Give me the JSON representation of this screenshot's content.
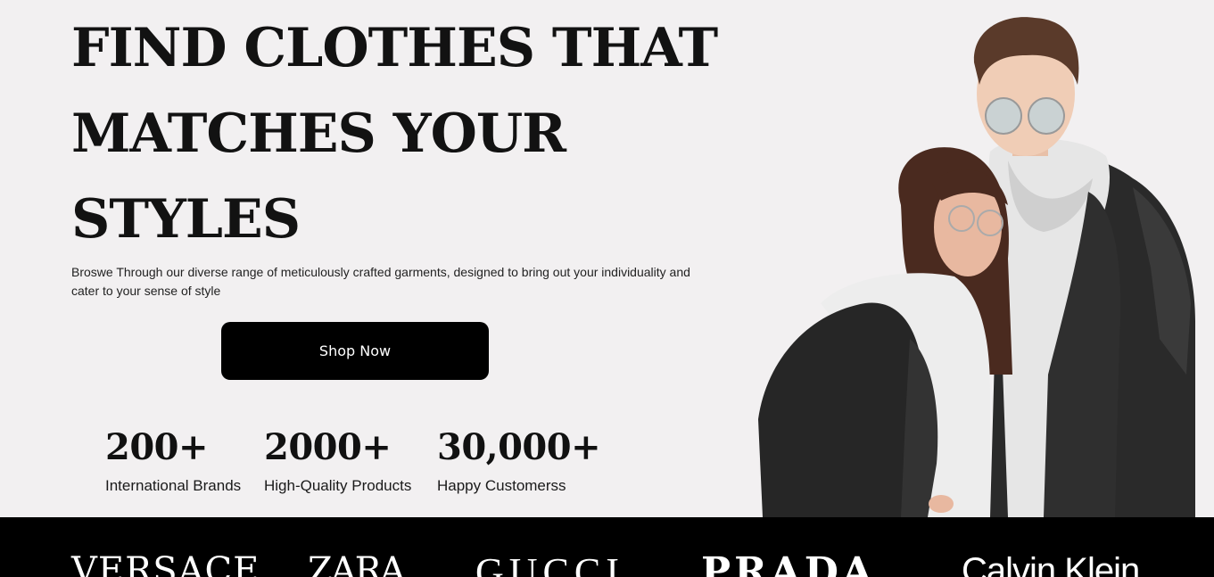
{
  "hero": {
    "headline_lines": [
      "FIND CLOTHES THAT",
      "MATCHES YOUR",
      "STYLES"
    ],
    "description": "Broswe Through our diverse range of meticulously crafted garments, designed to bring out your individuality and cater to your sense of style",
    "cta_label": "Shop Now",
    "stats": [
      {
        "value": "200+",
        "label": "International Brands"
      },
      {
        "value": "2000+",
        "label": "High-Quality Products"
      },
      {
        "value": "30,000+",
        "label": "Happy Customerss"
      }
    ]
  },
  "brands": [
    "VERSACE",
    "ZARA",
    "GUCCI",
    "PRADA",
    "Calvin Klein"
  ],
  "colors": {
    "hero_bg": "#F2F0F1",
    "button_bg": "#000000",
    "brand_bar_bg": "#000000",
    "text": "#000000"
  }
}
